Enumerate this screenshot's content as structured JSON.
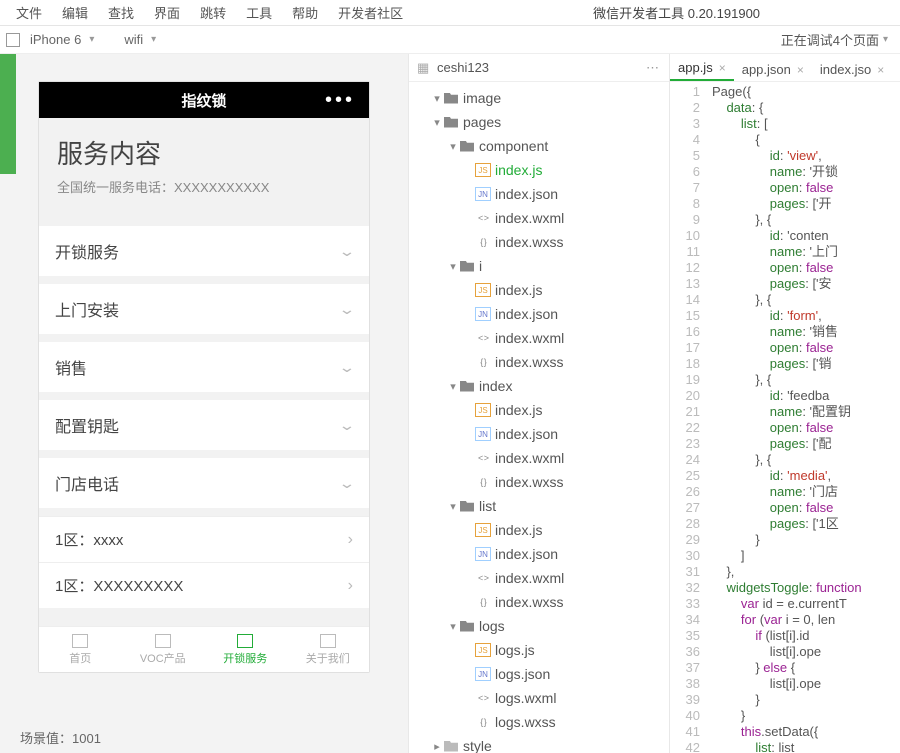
{
  "app_title": "微信开发者工具 0.20.191900",
  "menu": [
    "文件",
    "编辑",
    "查找",
    "界面",
    "跳转",
    "工具",
    "帮助",
    "开发者社区"
  ],
  "toolbar": {
    "device": "iPhone 6",
    "network": "wifi",
    "status": "正在调试4个页面"
  },
  "preview": {
    "title": "指纹锁",
    "headline": "服务内容",
    "subline": "全国统一服务电话：XXXXXXXXXXX",
    "items": [
      "开锁服务",
      "上门安装",
      "销售",
      "配置钥匙",
      "门店电话"
    ],
    "subitems": [
      "1区：xxxx",
      "1区：XXXXXXXXX"
    ],
    "tabs": [
      "首页",
      "VOC产品",
      "开锁服务",
      "关于我们"
    ],
    "active_tab_index": 2,
    "scene_label": "场景值：",
    "scene_value": "1001"
  },
  "project": {
    "name": "ceshi123",
    "tree": [
      {
        "t": "folder",
        "l": "image",
        "d": 1,
        "e": true
      },
      {
        "t": "folder",
        "l": "pages",
        "d": 1,
        "e": true
      },
      {
        "t": "folder",
        "l": "component",
        "d": 2,
        "e": true
      },
      {
        "t": "js",
        "l": "index.js",
        "d": 3,
        "sel": true
      },
      {
        "t": "json",
        "l": "index.json",
        "d": 3
      },
      {
        "t": "wxml",
        "l": "index.wxml",
        "d": 3
      },
      {
        "t": "wxss",
        "l": "index.wxss",
        "d": 3
      },
      {
        "t": "folder",
        "l": "i",
        "d": 2,
        "e": true
      },
      {
        "t": "js",
        "l": "index.js",
        "d": 3
      },
      {
        "t": "json",
        "l": "index.json",
        "d": 3
      },
      {
        "t": "wxml",
        "l": "index.wxml",
        "d": 3
      },
      {
        "t": "wxss",
        "l": "index.wxss",
        "d": 3
      },
      {
        "t": "folder",
        "l": "index",
        "d": 2,
        "e": true
      },
      {
        "t": "js",
        "l": "index.js",
        "d": 3
      },
      {
        "t": "json",
        "l": "index.json",
        "d": 3
      },
      {
        "t": "wxml",
        "l": "index.wxml",
        "d": 3
      },
      {
        "t": "wxss",
        "l": "index.wxss",
        "d": 3
      },
      {
        "t": "folder",
        "l": "list",
        "d": 2,
        "e": true
      },
      {
        "t": "js",
        "l": "index.js",
        "d": 3
      },
      {
        "t": "json",
        "l": "index.json",
        "d": 3
      },
      {
        "t": "wxml",
        "l": "index.wxml",
        "d": 3
      },
      {
        "t": "wxss",
        "l": "index.wxss",
        "d": 3
      },
      {
        "t": "folder",
        "l": "logs",
        "d": 2,
        "e": true
      },
      {
        "t": "js",
        "l": "logs.js",
        "d": 3
      },
      {
        "t": "json",
        "l": "logs.json",
        "d": 3
      },
      {
        "t": "wxml",
        "l": "logs.wxml",
        "d": 3
      },
      {
        "t": "wxss",
        "l": "logs.wxss",
        "d": 3
      },
      {
        "t": "folderc",
        "l": "style",
        "d": 1,
        "e": false
      }
    ]
  },
  "editor_tabs": [
    {
      "label": "app.js",
      "active": true
    },
    {
      "label": "app.json"
    },
    {
      "label": "index.jso"
    }
  ],
  "code_lines": [
    "Page({",
    "    data: {",
    "        list: [",
    "            {",
    "                id: 'view',",
    "                name: '开锁",
    "                open: false",
    "                pages: ['开",
    "            }, {",
    "                id: 'conten",
    "                name: '上门",
    "                open: false",
    "                pages: ['安",
    "            }, {",
    "                id: 'form',",
    "                name: '销售",
    "                open: false",
    "                pages: ['销",
    "            }, {",
    "                id: 'feedba",
    "                name: '配置钥",
    "                open: false",
    "                pages: ['配",
    "            }, {",
    "                id: 'media',",
    "                name: '门店",
    "                open: false",
    "                pages: ['1区",
    "            }",
    "        ]",
    "    },",
    "    widgetsToggle: function",
    "        var id = e.currentT",
    "        for (var i = 0, len",
    "            if (list[i].id ",
    "                list[i].ope",
    "            } else {",
    "                list[i].ope",
    "            }",
    "        }",
    "        this.setData({",
    "            list: list"
  ]
}
